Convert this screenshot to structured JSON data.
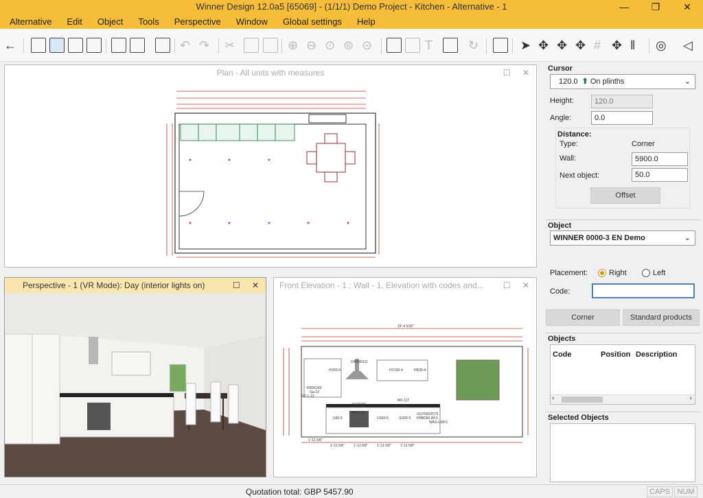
{
  "window": {
    "title": "Winner Design 12.0a5   [65069] - (1/1/1) Demo Project - Kitchen - Alternative - 1",
    "min": "—",
    "max": "❐",
    "close": "✕"
  },
  "menu": [
    "Alternative",
    "Edit",
    "Object",
    "Tools",
    "Perspective",
    "Window",
    "Global settings",
    "Help"
  ],
  "panes": {
    "plan": {
      "title": "Plan - All units with measures"
    },
    "perspective": {
      "title": "Perspective - 1 (VR Mode): Day (interior lights on)"
    },
    "front": {
      "title": "Front Elevation - 1 : Wall - 1, Elevation with codes and..."
    },
    "btn_max": "☐",
    "btn_close": "✕"
  },
  "elevation_labels": {
    "top_dim": "19'-4 5/16\"",
    "codes": [
      "DAW99111",
      "HV60-4",
      "HV100-4",
      "HR30-4",
      "KBD6243",
      "Ga-13",
      "SP-1-13",
      "KF10150",
      "MX-11T",
      "ESP-1",
      "BO1-TS",
      "U60-5",
      "US60-5",
      "SO60-5",
      "GSYS6025TS",
      "KBBD60-IM-5",
      "WAS-US8-5"
    ],
    "bottom_dims": [
      "1'-11 5/8\"",
      "1'-11 5/8\"",
      "1'-11 5/8\"",
      "1'-11 5/8\"",
      "1'-11 5/8\""
    ]
  },
  "right_panel": {
    "cursor": {
      "heading": "Cursor",
      "height_value": "120.0",
      "mode": "On plinths",
      "height_label": "Height:",
      "height_field": "120.0",
      "angle_label": "Angle:",
      "angle_field": "0.0",
      "distance_heading": "Distance:",
      "type_label": "Type:",
      "type_value": "Corner",
      "wall_label": "Wall:",
      "wall_value": "5900.0",
      "next_label": "Next object:",
      "next_value": "50.0",
      "offset_button": "Offset"
    },
    "object": {
      "heading": "Object",
      "catalog": "WINNER 0000-3 EN Demo",
      "placement_label": "Placement:",
      "right_option": "Right",
      "left_option": "Left",
      "placement_selected": "Right",
      "code_label": "Code:",
      "code_value": ""
    },
    "corner_button": "Corner",
    "standard_products_button": "Standard products",
    "objects": {
      "heading": "Objects",
      "columns": [
        "Code",
        "Position",
        "Description"
      ]
    },
    "selected_heading": "Selected Objects"
  },
  "status": {
    "quotation": "Quotation total: GBP 5457.90",
    "caps": "CAPS",
    "num": "NUM"
  },
  "colors": {
    "accent": "#f5bd3a",
    "dimension": "#c0392b"
  }
}
